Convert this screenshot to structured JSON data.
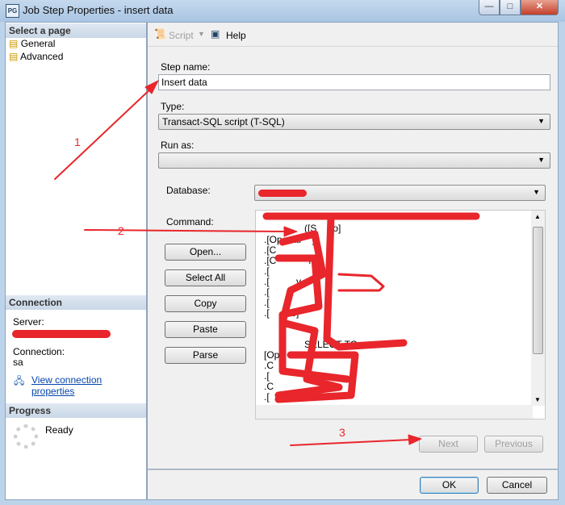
{
  "window": {
    "title": "Job Step Properties - insert data",
    "app_icon": "PG",
    "controls": {
      "minimize": "—",
      "maximize": "□",
      "close": "✕"
    }
  },
  "sidebar": {
    "select_page_header": "Select a page",
    "pages": [
      {
        "label": "General",
        "icon": "page-properties-icon"
      },
      {
        "label": "Advanced",
        "icon": "page-properties-icon"
      }
    ],
    "connection_header": "Connection",
    "server_label": "Server:",
    "connection_label": "Connection:",
    "connection_value": "sa",
    "view_connection_link": "View connection properties",
    "progress_header": "Progress",
    "progress_status": "Ready"
  },
  "toolbar": {
    "script_label": "Script",
    "help_label": "Help"
  },
  "form": {
    "step_name_label": "Step name:",
    "step_name_value": "Insert data",
    "type_label": "Type:",
    "type_value": "Transact-SQL script (T-SQL)",
    "run_as_label": "Run as:",
    "run_as_value": "",
    "database_label": "Database:",
    "command_label": "Command:",
    "command_buttons": [
      "Open...",
      "Select All",
      "Copy",
      "Paste",
      "Parse"
    ],
    "command_visible_fragments": [
      "([S      o]",
      ".[Operati    y",
      ".[C",
      ".[C            No]",
      ".[",
      ".[          y     ]",
      ".[",
      ".[",
      ".[        o]",
      "SELECT TO",
      "[Op     ion",
      ".C",
      ".[              ]",
      ".C",
      ".["
    ],
    "next_label": "Next",
    "previous_label": "Previous"
  },
  "footer": {
    "ok_label": "OK",
    "cancel_label": "Cancel"
  },
  "annotations": {
    "labels": [
      "1",
      "2",
      "3"
    ],
    "color": "#e8262b"
  }
}
